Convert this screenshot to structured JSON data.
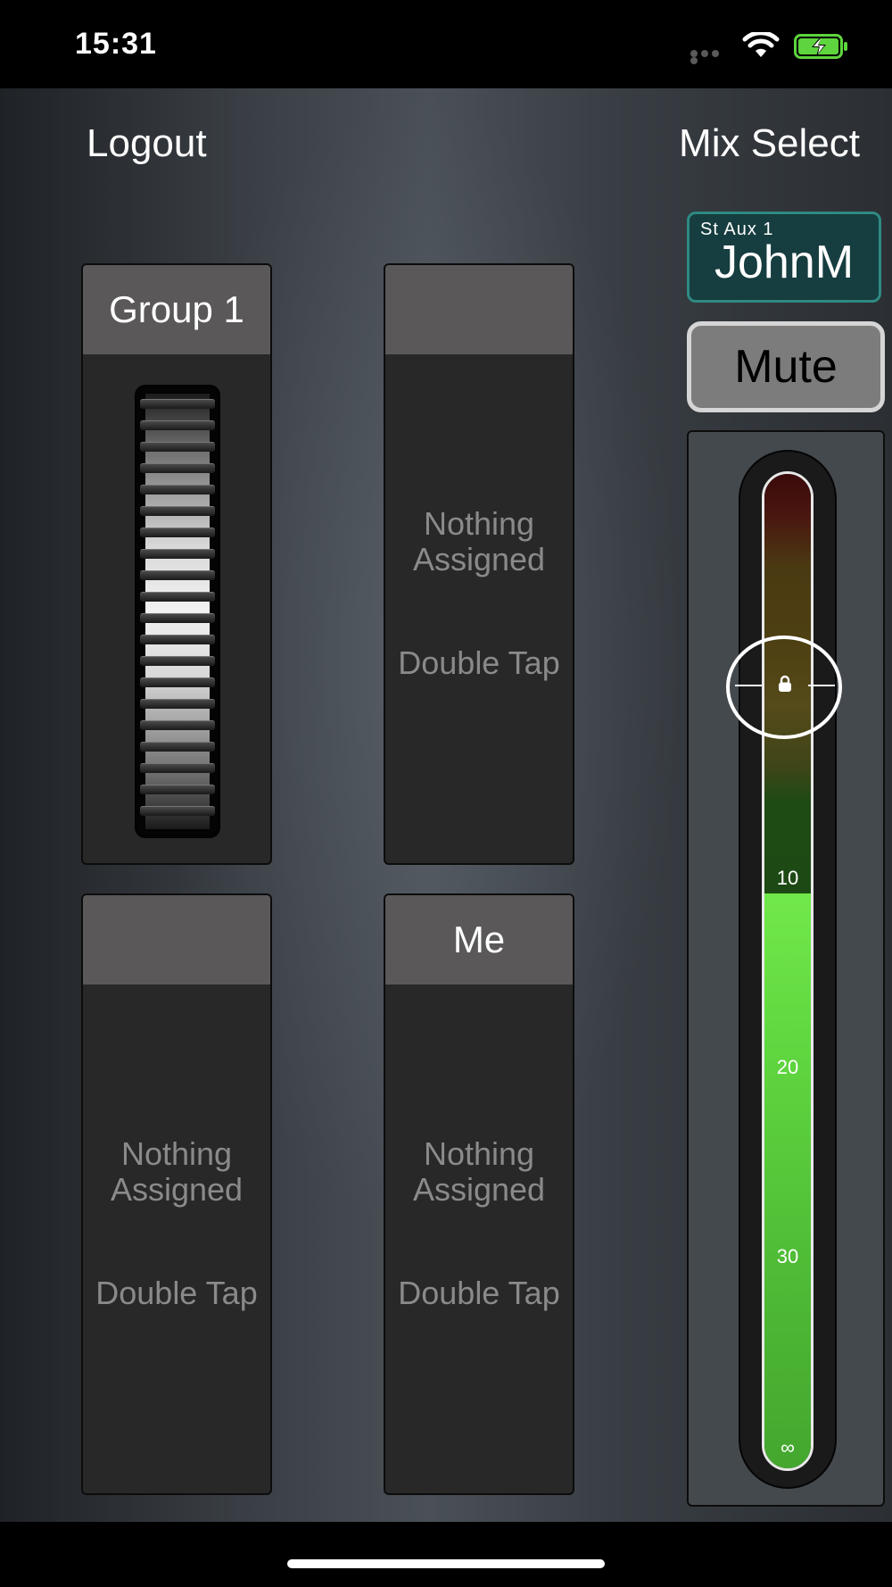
{
  "status": {
    "time": "15:31",
    "icons": [
      "signal-dots-icon",
      "wifi-icon",
      "battery-charging-icon"
    ],
    "battery_color": "#5ed43e"
  },
  "nav": {
    "logout": "Logout",
    "mix_select": "Mix Select"
  },
  "panels": [
    {
      "title": "Group 1",
      "content": "fader"
    },
    {
      "title": "",
      "empty_text": "Nothing Assigned",
      "hint": "Double Tap"
    },
    {
      "title": "",
      "empty_text": "Nothing Assigned",
      "hint": "Double Tap"
    },
    {
      "title": "Me",
      "empty_text": "Nothing Assigned",
      "hint": "Double Tap"
    }
  ],
  "mix": {
    "aux_label": "St Aux 1",
    "aux_name": "JohnM",
    "mute_label": "Mute",
    "scale_ticks": [
      "10",
      "20",
      "30",
      "∞"
    ],
    "accent_color": "#2e8a82"
  }
}
